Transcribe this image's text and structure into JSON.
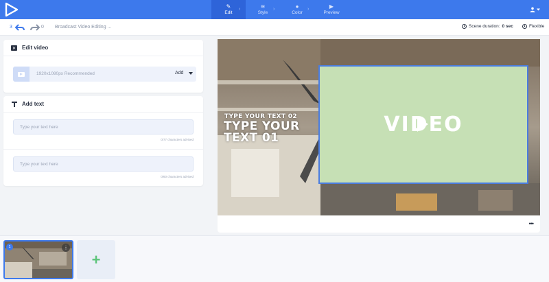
{
  "nav": {
    "steps": [
      {
        "label": "Edit",
        "icon": "pencil-icon",
        "active": true
      },
      {
        "label": "Style",
        "icon": "layers-icon",
        "active": false
      },
      {
        "label": "Color",
        "icon": "palette-icon",
        "active": false
      },
      {
        "label": "Preview",
        "icon": "play-icon",
        "active": false
      }
    ],
    "accent_color": "#3d79ec"
  },
  "subbar": {
    "undo_count": "3",
    "redo_count": "0",
    "project_title": "Broadcast Video Editing ...",
    "scene_duration_label": "Scene duration:",
    "scene_duration_value": "0 sec",
    "flexible_label": "Flexible"
  },
  "edit_video": {
    "title": "Edit video",
    "hint": "1920x1080px Recommended",
    "add_label": "Add"
  },
  "add_text": {
    "title": "Add text",
    "fields": [
      {
        "placeholder": "Type your text here",
        "counter": "0/77 characters advised"
      },
      {
        "placeholder": "Type your text here",
        "counter": "0/60 characters advised"
      }
    ]
  },
  "preview": {
    "heading_small": "TYPE YOUR TEXT 02",
    "heading_big": "TYPE YOUR TEXT 01",
    "video_label": "VIDEO",
    "more_label": "•••"
  },
  "timeline": {
    "scene_number": "1",
    "scene_menu": "⋮",
    "add_scene_label": "+"
  }
}
